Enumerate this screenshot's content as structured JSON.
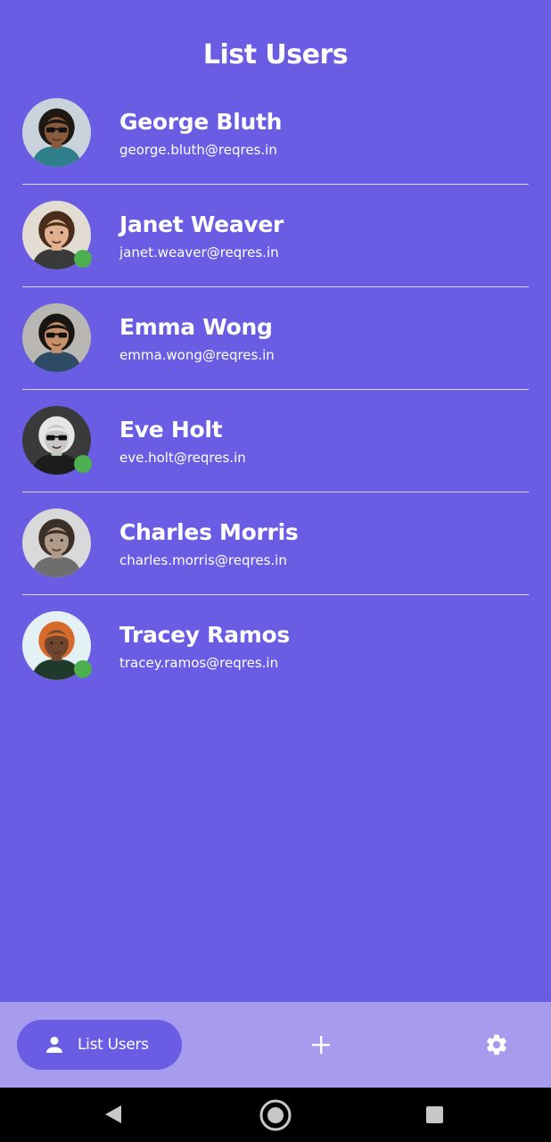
{
  "header": {
    "title": "List Users"
  },
  "users": [
    {
      "name": "George Bluth",
      "email": "george.bluth@reqres.in",
      "online": false,
      "avatar": {
        "bg": "#c9d3db",
        "skin": "#8a5a3c",
        "hair": "#1e1712",
        "shirt": "#2f7f8c",
        "glasses": true
      }
    },
    {
      "name": "Janet Weaver",
      "email": "janet.weaver@reqres.in",
      "online": true,
      "avatar": {
        "bg": "#e3dcd2",
        "skin": "#e0b08f",
        "hair": "#4a2c1a",
        "shirt": "#3a3a3a",
        "glasses": false
      }
    },
    {
      "name": "Emma Wong",
      "email": "emma.wong@reqres.in",
      "online": false,
      "avatar": {
        "bg": "#b9b7b3",
        "skin": "#c58f6a",
        "hair": "#191512",
        "shirt": "#2d4a66",
        "glasses": true
      }
    },
    {
      "name": "Eve Holt",
      "email": "eve.holt@reqres.in",
      "online": true,
      "avatar": {
        "bg": "#3a3a3a",
        "skin": "#c7c7c7",
        "hair": "#e6e6e6",
        "shirt": "#1c1c1c",
        "glasses": true
      }
    },
    {
      "name": "Charles Morris",
      "email": "charles.morris@reqres.in",
      "online": false,
      "avatar": {
        "bg": "#d9d9d9",
        "skin": "#b09a8a",
        "hair": "#3b3028",
        "shirt": "#6e6e6e",
        "glasses": false
      }
    },
    {
      "name": "Tracey Ramos",
      "email": "tracey.ramos@reqres.in",
      "online": true,
      "avatar": {
        "bg": "#e4f1f4",
        "skin": "#6e4630",
        "hair": "#d56a2a",
        "shirt": "#1f3a2a",
        "glasses": false
      }
    }
  ],
  "bottom_nav": {
    "active_label": "List Users",
    "items": [
      {
        "icon": "person-icon",
        "label": "List Users"
      },
      {
        "icon": "plus-icon"
      },
      {
        "icon": "gear-icon"
      }
    ]
  },
  "colors": {
    "background": "#6a5ce3",
    "nav_background": "#a69bec",
    "online": "#4caf50",
    "divider": "#ffffff"
  },
  "system_bar": {
    "icons": [
      "back-icon",
      "home-icon",
      "recents-icon"
    ]
  }
}
